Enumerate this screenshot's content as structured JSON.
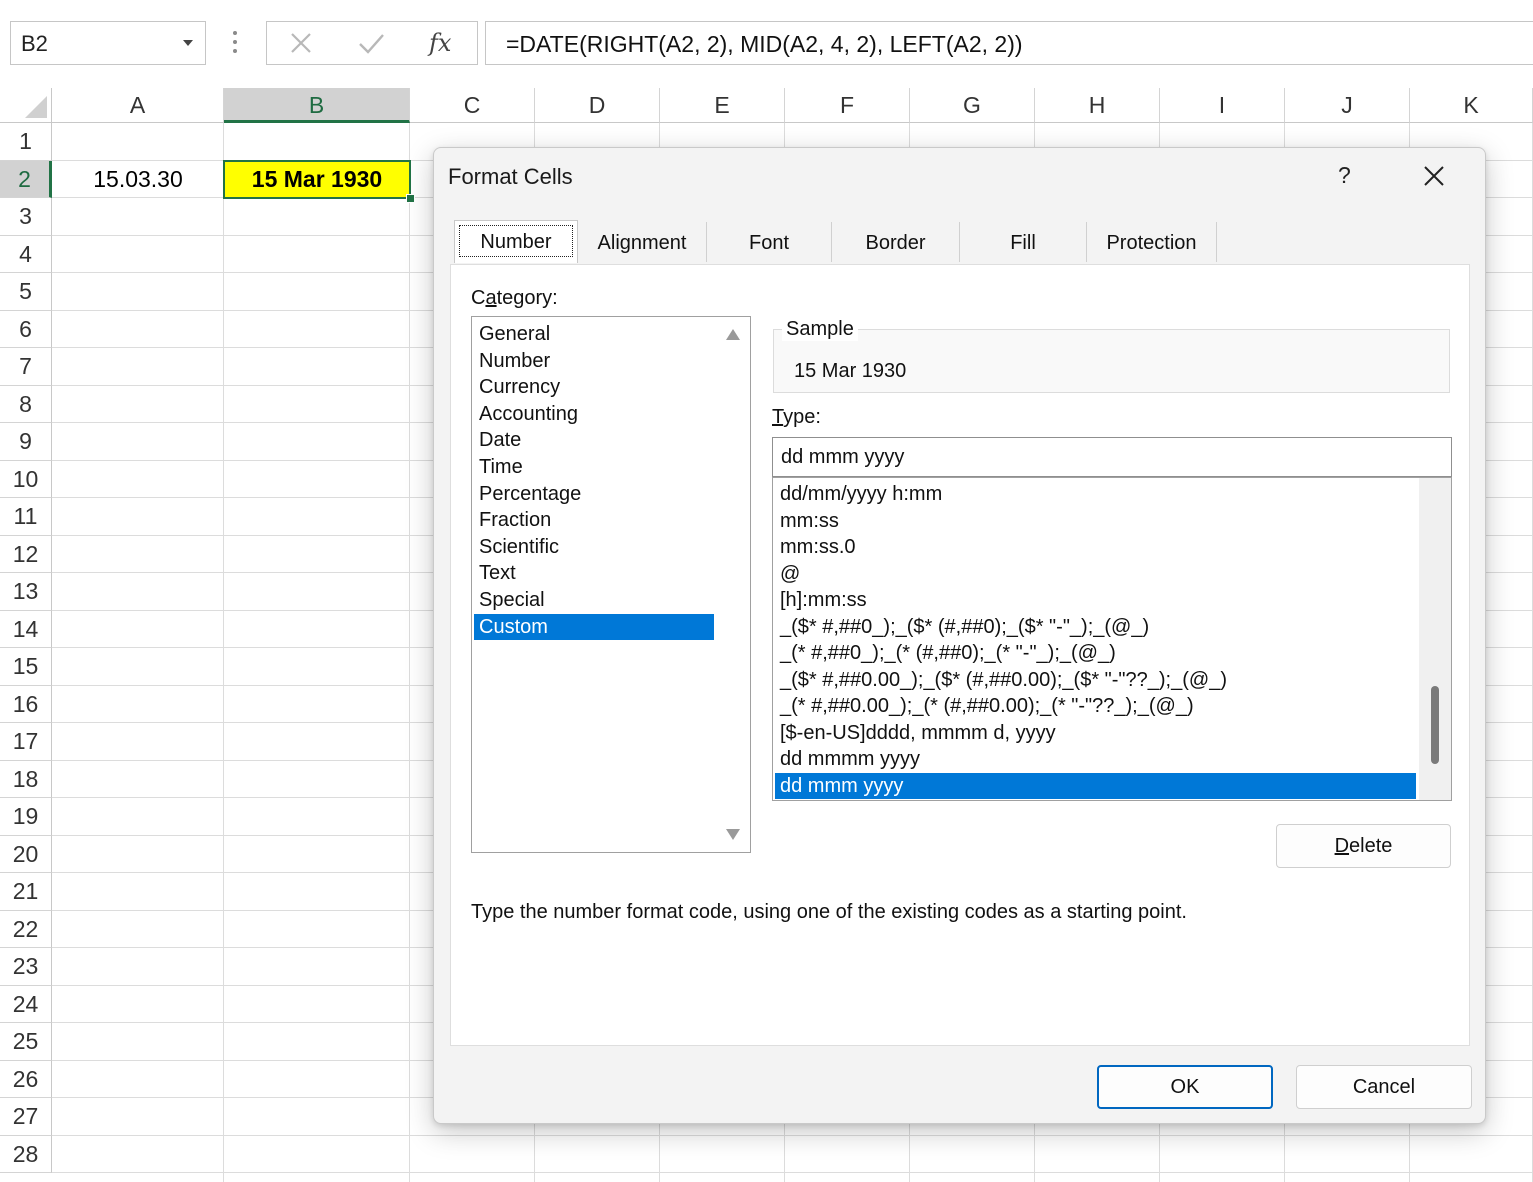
{
  "formula_bar": {
    "name_box": "B2",
    "formula": "=DATE(RIGHT(A2, 2), MID(A2, 4, 2), LEFT(A2, 2))",
    "icons": [
      "cancel-icon",
      "enter-icon",
      "insert-function-icon"
    ]
  },
  "grid": {
    "columns": [
      "A",
      "B",
      "C",
      "D",
      "E",
      "F",
      "G",
      "H",
      "I",
      "J",
      "K"
    ],
    "selected_column": "B",
    "rows": [
      "1",
      "2",
      "3",
      "4",
      "5",
      "6",
      "7",
      "8",
      "9",
      "10",
      "11",
      "12",
      "13",
      "14",
      "15",
      "16",
      "17",
      "18",
      "19",
      "20",
      "21",
      "22",
      "23",
      "24",
      "25",
      "26",
      "27",
      "28"
    ],
    "selected_row": "2",
    "cells": {
      "A2": "15.03.30",
      "B2": "15 Mar 1930"
    },
    "b2_fill_color": "#ffff00",
    "selection_color": "#217346"
  },
  "dialog": {
    "title": "Format Cells",
    "help": "?",
    "tabs": [
      "Number",
      "Alignment",
      "Font",
      "Border",
      "Fill",
      "Protection"
    ],
    "active_tab": "Number",
    "category_label_prefix": "C",
    "category_label_underlined": "a",
    "category_label_suffix": "tegory:",
    "categories": [
      "General",
      "Number",
      "Currency",
      "Accounting",
      "Date",
      "Time",
      "Percentage",
      "Fraction",
      "Scientific",
      "Text",
      "Special",
      "Custom"
    ],
    "selected_category": "Custom",
    "sample_label": "Sample",
    "sample_value": "15 Mar 1930",
    "type_label_underlined": "T",
    "type_label_suffix": "ype:",
    "type_value": "dd mmm yyyy",
    "type_list": [
      "dd/mm/yyyy h:mm",
      "mm:ss",
      "mm:ss.0",
      "@",
      "[h]:mm:ss",
      "_($* #,##0_);_($* (#,##0);_($* \"-\"_);_(@_)",
      "_(* #,##0_);_(* (#,##0);_(* \"-\"_);_(@_)",
      "_($* #,##0.00_);_($* (#,##0.00);_($* \"-\"??_);_(@_)",
      "_(* #,##0.00_);_(* (#,##0.00);_(* \"-\"??_);_(@_)",
      "[$-en-US]dddd, mmmm d, yyyy",
      "dd mmmm yyyy",
      "dd mmm yyyy"
    ],
    "selected_type": "dd mmm yyyy",
    "delete_underlined": "D",
    "delete_suffix": "elete",
    "hint": "Type the number format code, using one of the existing codes as a starting point.",
    "ok_label": "OK",
    "cancel_label": "Cancel",
    "accent_color": "#0078d7"
  }
}
